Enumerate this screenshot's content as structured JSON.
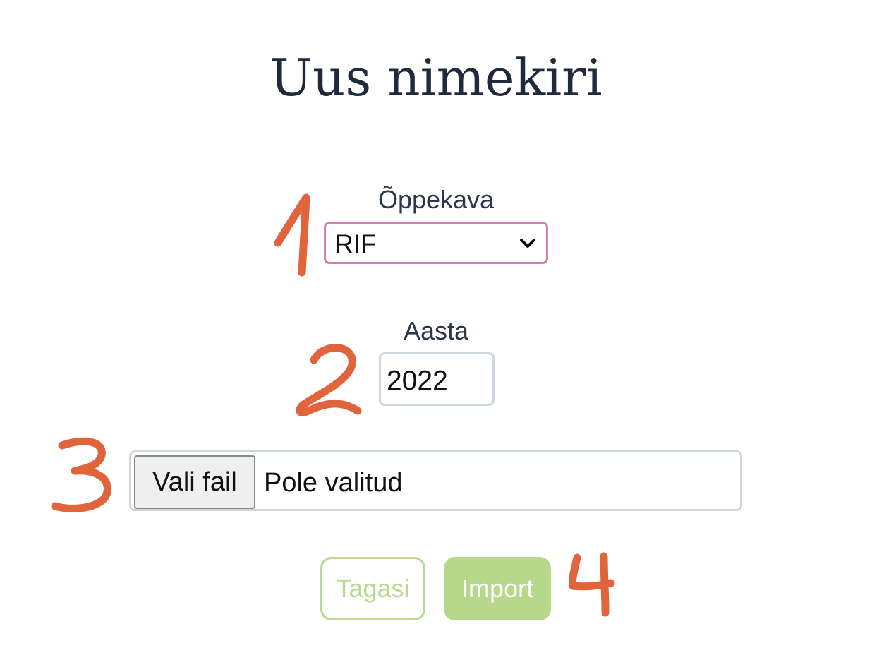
{
  "page": {
    "title": "Uus nimekiri"
  },
  "form": {
    "curriculum": {
      "label": "Õppekava",
      "selected": "RIF"
    },
    "year": {
      "label": "Aasta",
      "value": "2022"
    },
    "file": {
      "button_label": "Vali fail",
      "status": "Pole valitud"
    },
    "buttons": {
      "back_label": "Tagasi",
      "import_label": "Import"
    }
  },
  "annotations": {
    "marker_1": "1",
    "marker_2": "2",
    "marker_3": "3",
    "marker_4": "4",
    "color": "#e0643c"
  },
  "colors": {
    "title": "#1f2a3c",
    "select_border": "#d47fb0",
    "input_border": "#cfd6de",
    "accent_green": "#b5d88a"
  }
}
